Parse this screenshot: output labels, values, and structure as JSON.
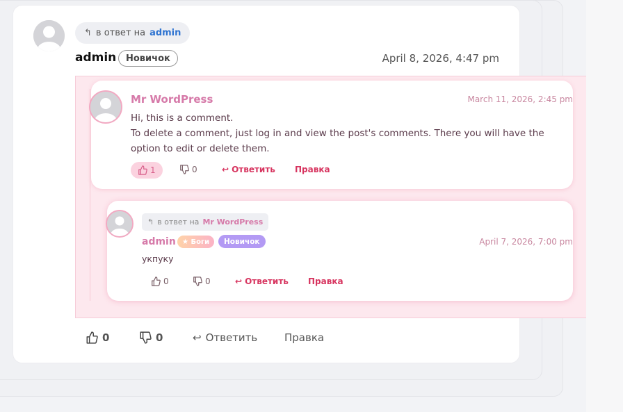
{
  "main_comment": {
    "reply_to_prefix": "в ответ на",
    "reply_to_name": "admin",
    "author": "admin",
    "badge": "Новичок",
    "date": "April 8, 2026, 4:47 pm",
    "likes": "0",
    "dislikes": "0",
    "reply_label": "Ответить",
    "edit_label": "Правка"
  },
  "quoted_comment": {
    "author": "Mr WordPress",
    "date": "March 11, 2026, 2:45 pm",
    "text_line1": "Hi, this is a comment.",
    "text_line2": "To delete a comment, just log in and view the post's comments. There you will have the option to edit or delete them.",
    "likes": "1",
    "dislikes": "0",
    "reply_label": "Ответить",
    "edit_label": "Правка"
  },
  "nested_reply": {
    "reply_to_prefix": "в ответ на",
    "reply_to_name": "Mr WordPress",
    "author": "admin",
    "badge_special": "★ Боги",
    "badge": "Новичок",
    "date": "April 7, 2026, 7:00 pm",
    "text": "укпуку",
    "likes": "0",
    "dislikes": "0",
    "reply_label": "Ответить",
    "edit_label": "Правка"
  },
  "colors": {
    "accent_blue": "#2f74d1",
    "pink_author": "#d67aa9",
    "action_red": "#d7345f",
    "badge_purple": "#b39af4"
  },
  "icons": [
    "reply-arrow-icon",
    "avatar-placeholder-icon",
    "thumbs-up-icon",
    "thumbs-down-icon",
    "reply-icon"
  ]
}
